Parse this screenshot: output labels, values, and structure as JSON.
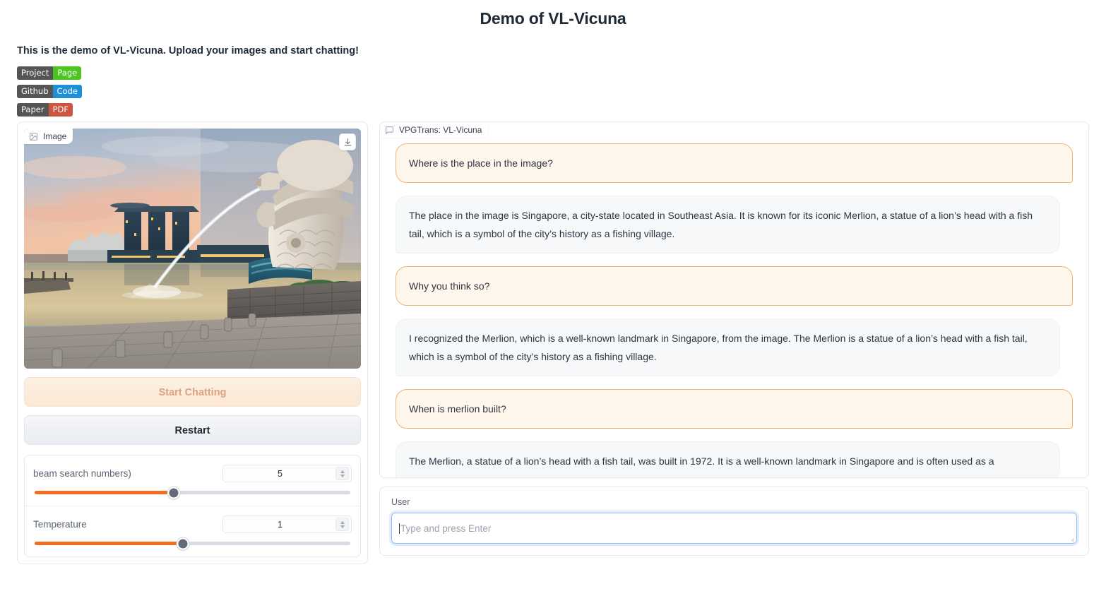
{
  "header": {
    "title": "Demo of VL-Vicuna",
    "subtitle": "This is the demo of VL-Vicuna. Upload your images and start chatting!"
  },
  "badges": [
    {
      "left": "Project",
      "right": "Page",
      "right_color": "#4cc61e",
      "left_color": "#555555"
    },
    {
      "left": "Github",
      "right": "Code",
      "right_color": "#1f8fd6",
      "left_color": "#555555"
    },
    {
      "left": "Paper",
      "right": "PDF",
      "right_color": "#cf5540",
      "left_color": "#555555"
    }
  ],
  "image_panel": {
    "label": "Image",
    "label_icon": "image-icon",
    "download_icon": "download-icon",
    "alt": "Merlion statue spouting water at Marina Bay Singapore at sunset with Marina Bay Sands in background"
  },
  "buttons": {
    "start_chatting": "Start Chatting",
    "restart": "Restart"
  },
  "sliders": [
    {
      "label": "beam search numbers)",
      "value": "5",
      "fill_percent": 44,
      "thumb_percent": 44
    },
    {
      "label": "Temperature",
      "value": "1",
      "fill_percent": 47,
      "thumb_percent": 47
    }
  ],
  "chat": {
    "panel_label": "VPGTrans: VL-Vicuna",
    "panel_icon": "chat-bubble-icon",
    "messages": [
      {
        "role": "user",
        "text": "Where is the place in the image?"
      },
      {
        "role": "bot",
        "text": "The place in the image is Singapore, a city-state located in Southeast Asia. It is known for its iconic Merlion, a statue of a lion’s head with a fish tail, which is a symbol of the city’s history as a fishing village."
      },
      {
        "role": "user",
        "text": "Why you think so?"
      },
      {
        "role": "bot",
        "text": "I recognized the Merlion, which is a well-known landmark in Singapore, from the image. The Merlion is a statue of a lion’s head with a fish tail, which is a symbol of the city’s history as a fishing village."
      },
      {
        "role": "user",
        "text": "When is merlion built?"
      },
      {
        "role": "bot",
        "text": "The Merlion, a statue of a lion’s head with a fish tail, was built in 1972. It is a well-known landmark in Singapore and is often used as a"
      }
    ]
  },
  "input": {
    "label": "User",
    "placeholder": "Type and press Enter",
    "value": ""
  },
  "colors": {
    "accent_orange": "#ef6c20",
    "user_bubble_bg": "#fff6ec",
    "user_bubble_border": "#f0b476",
    "bot_bubble_bg": "#f6f8fa",
    "focus_blue": "#93bdf0"
  }
}
